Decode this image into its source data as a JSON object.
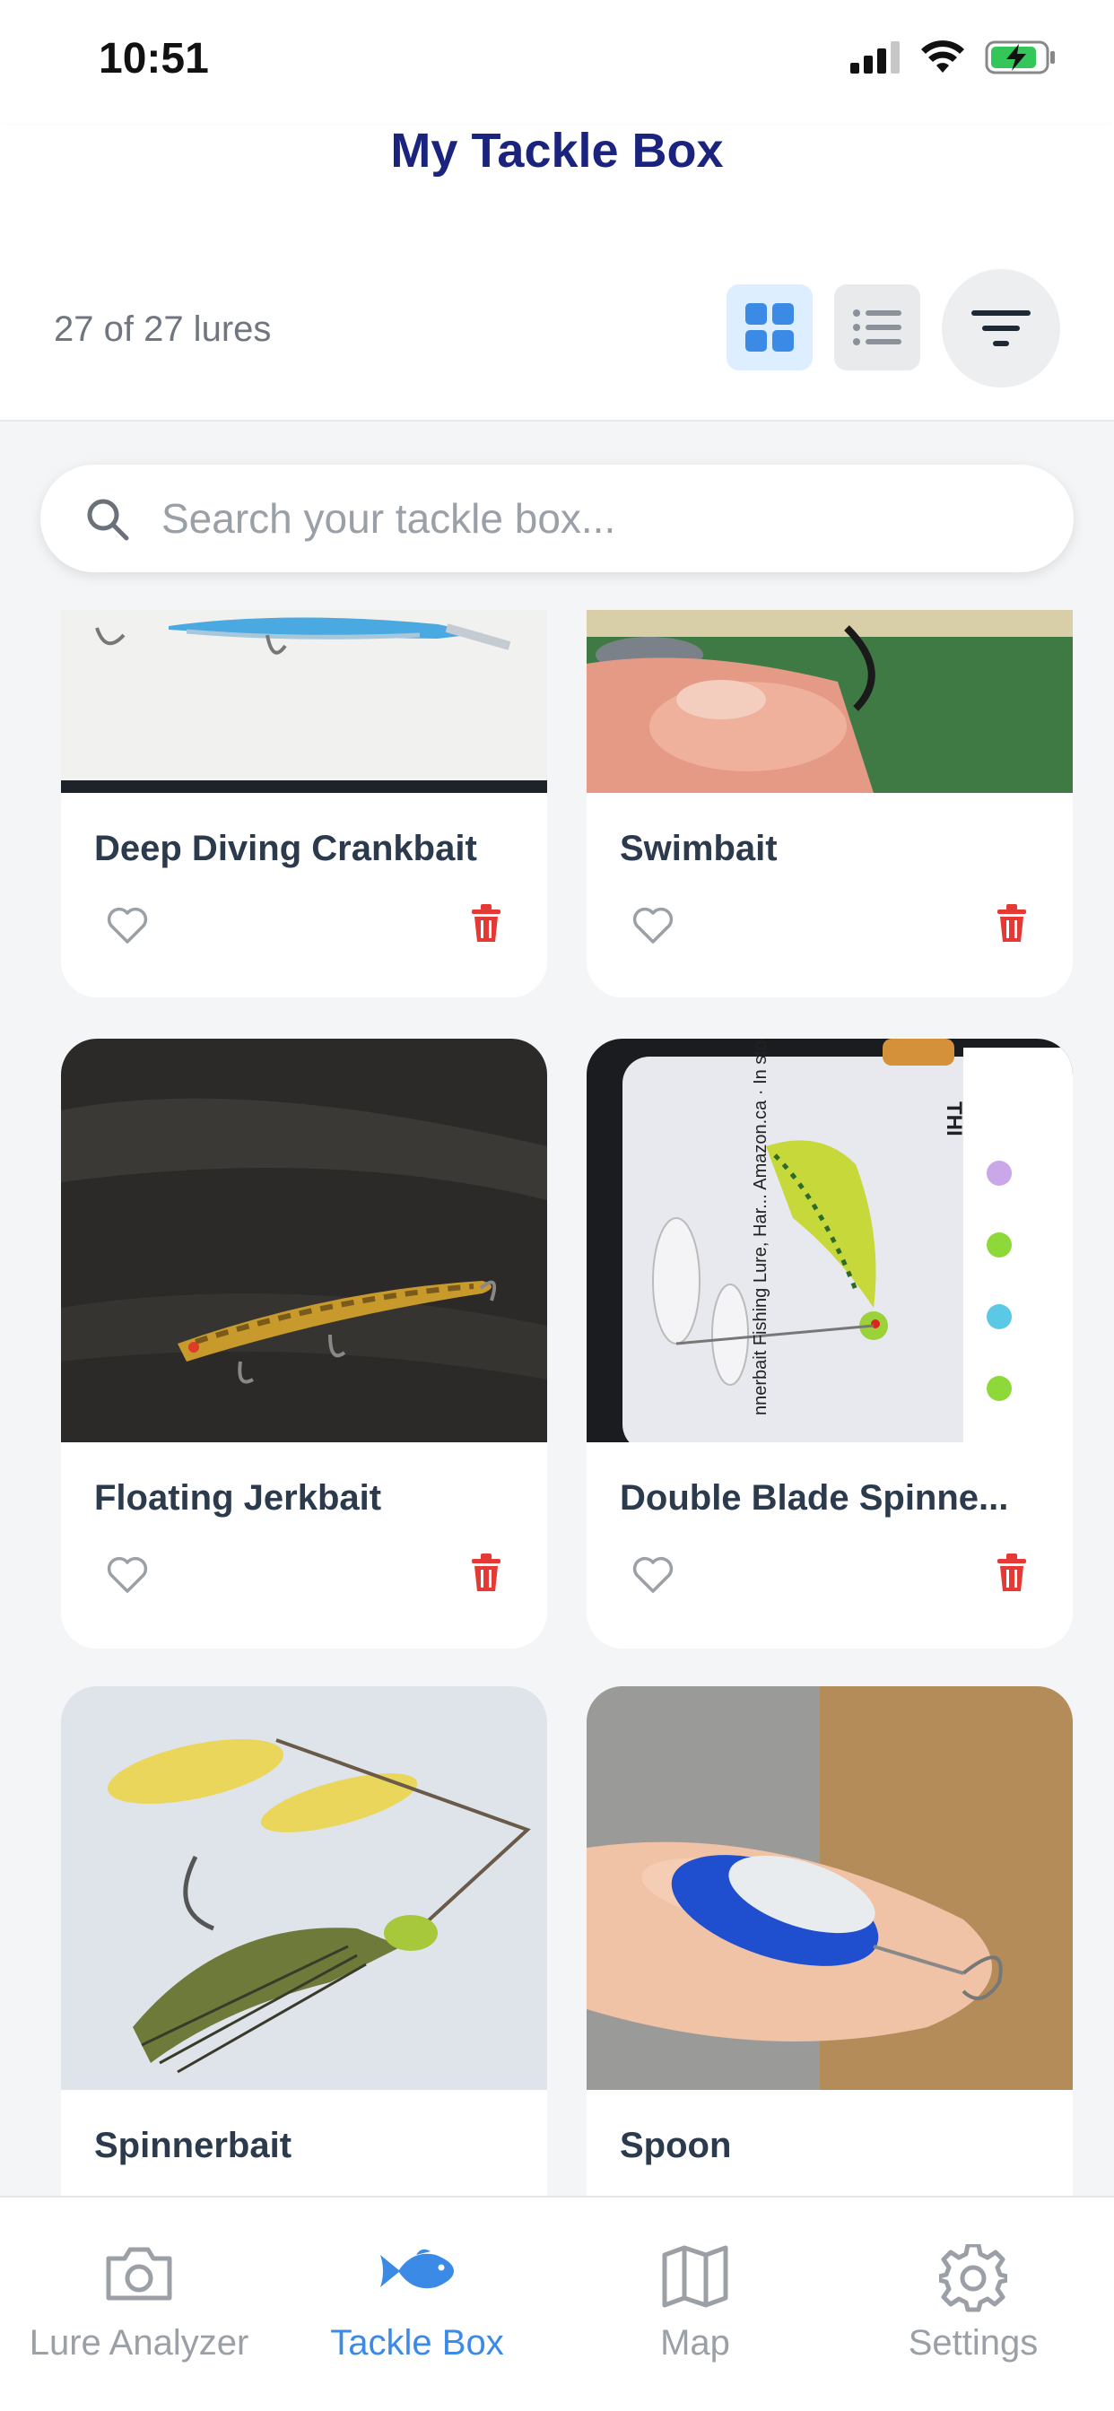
{
  "status_bar": {
    "time": "10:51"
  },
  "header": {
    "title": "My Tackle Box"
  },
  "toolbar": {
    "count_text": "27 of 27 lures"
  },
  "search": {
    "placeholder": "Search your tackle box..."
  },
  "lures": [
    {
      "name": "Deep Diving Crankbait",
      "favorite": false
    },
    {
      "name": "Swimbait",
      "favorite": false
    },
    {
      "name": "Floating Jerkbait",
      "favorite": false
    },
    {
      "name": "Double Blade Spinne...",
      "favorite": false
    },
    {
      "name": "Spinnerbait",
      "favorite": false
    },
    {
      "name": "Spoon",
      "favorite": false
    }
  ],
  "photo_overlay_text": {
    "amazon_listing": "nnerbait Fishing Lure, Har... Amazon.ca · In stock",
    "tag": "THI"
  },
  "tabs": [
    {
      "label": "Lure Analyzer",
      "icon": "camera-icon",
      "active": false
    },
    {
      "label": "Tackle Box",
      "icon": "fish-icon",
      "active": true
    },
    {
      "label": "Map",
      "icon": "map-icon",
      "active": false
    },
    {
      "label": "Settings",
      "icon": "gear-icon",
      "active": false
    }
  ],
  "colors": {
    "title": "#1a237e",
    "accent": "#3b8ae6",
    "delete": "#e53935",
    "inactive": "#9aa0a6"
  }
}
